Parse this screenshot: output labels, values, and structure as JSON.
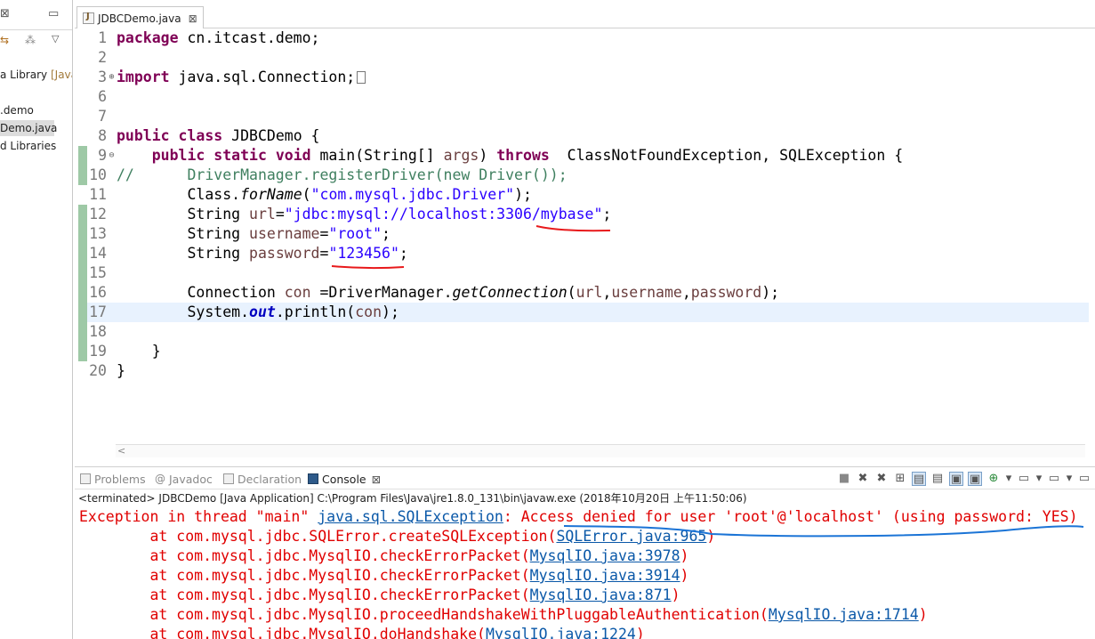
{
  "left": {
    "close_glyph": "⊠",
    "minimize_glyph": "▭",
    "menu_glyph": "▽",
    "items": [
      {
        "label": "a Library",
        "suffix": "[Java"
      },
      {
        "label": ".demo",
        "suffix": ""
      },
      {
        "label": "Demo.java",
        "suffix": ""
      },
      {
        "label": "d Libraries",
        "suffix": ""
      }
    ]
  },
  "editor": {
    "tab_label": "JDBCDemo.java",
    "tab_close": "⊠",
    "lines": [
      {
        "num": "1",
        "fold": ""
      },
      {
        "num": "2",
        "fold": ""
      },
      {
        "num": "3",
        "fold": "⊕"
      },
      {
        "num": "6",
        "fold": ""
      },
      {
        "num": "7",
        "fold": ""
      },
      {
        "num": "8",
        "fold": ""
      },
      {
        "num": "9",
        "fold": "⊖"
      },
      {
        "num": "10",
        "fold": ""
      },
      {
        "num": "11",
        "fold": ""
      },
      {
        "num": "12",
        "fold": ""
      },
      {
        "num": "13",
        "fold": ""
      },
      {
        "num": "14",
        "fold": ""
      },
      {
        "num": "15",
        "fold": ""
      },
      {
        "num": "16",
        "fold": ""
      },
      {
        "num": "17",
        "fold": ""
      },
      {
        "num": "18",
        "fold": ""
      },
      {
        "num": "19",
        "fold": ""
      },
      {
        "num": "20",
        "fold": ""
      }
    ],
    "code": {
      "l1_kw": "package",
      "l1_rest": " cn.itcast.demo;",
      "l3_kw": "import",
      "l3_rest": " java.sql.Connection;",
      "l8_kw": "public class",
      "l8_rest": " JDBCDemo {",
      "l9_indent": "    ",
      "l9_kw1": "public static void",
      "l9_mid": " main(String[] ",
      "l9_var": "args",
      "l9_sp": ") ",
      "l9_kw2": "throws",
      "l9_rest": "  ClassNotFoundException, SQLException {",
      "l10": "//      DriverManager.registerDriver(new Driver());",
      "l11_indent": "        ",
      "l11_a": "Class.",
      "l11_b": "forName",
      "l11_c": "(",
      "l11_str": "\"com.mysql.jdbc.Driver\"",
      "l11_d": ");",
      "l12_a": "        String ",
      "l12_var": "url",
      "l12_eq": "=",
      "l12_str": "\"jdbc:mysql://localhost:3306/mybase\"",
      "l12_end": ";",
      "l13_a": "        String ",
      "l13_var": "username",
      "l13_eq": "=",
      "l13_str": "\"root\"",
      "l13_end": ";",
      "l14_a": "        String ",
      "l14_var": "password",
      "l14_eq": "=",
      "l14_str": "\"123456\"",
      "l14_end": ";",
      "l16_a": "        Connection ",
      "l16_var": "con",
      "l16_b": " =DriverManager.",
      "l16_m": "getConnection",
      "l16_c": "(",
      "l16_v1": "url",
      "l16_comma1": ",",
      "l16_v2": "username",
      "l16_comma2": ",",
      "l16_v3": "password",
      "l16_d": ");",
      "l17_a": "        System.",
      "l17_out": "out",
      "l17_b": ".println(",
      "l17_var": "con",
      "l17_c": ");",
      "l19": "    }",
      "l20": "}"
    },
    "hscroll_arrow": "<"
  },
  "console_view": {
    "tabs": [
      {
        "label": "Problems"
      },
      {
        "label": "Javadoc"
      },
      {
        "label": "Declaration"
      },
      {
        "label": "Console"
      }
    ],
    "tab_close": "⊠",
    "terminated": "<terminated> JDBCDemo [Java Application] C:\\Program Files\\Java\\jre1.8.0_131\\bin\\javaw.exe (2018年10月20日 上午11:50:06)",
    "toolbar_glyphs": [
      "■",
      "✖",
      "✖",
      "⊞",
      "▤",
      "▤",
      "▣",
      "▣",
      "⊕",
      "▾",
      "▭",
      "▾",
      "▭",
      "▾",
      "▭"
    ],
    "exception": {
      "prefix": "Exception in thread \"main\" ",
      "type_link": "java.sql.SQLException",
      "message": ": Access denied for user 'root'@'localhost' (using password: YES)"
    },
    "stack": [
      {
        "at": "        at com.mysql.jdbc.SQLError.createSQLException(",
        "link": "SQLError.java:965",
        "end": ")"
      },
      {
        "at": "        at com.mysql.jdbc.MysqlIO.checkErrorPacket(",
        "link": "MysqlIO.java:3978",
        "end": ")"
      },
      {
        "at": "        at com.mysql.jdbc.MysqlIO.checkErrorPacket(",
        "link": "MysqlIO.java:3914",
        "end": ")"
      },
      {
        "at": "        at com.mysql.jdbc.MysqlIO.checkErrorPacket(",
        "link": "MysqlIO.java:871",
        "end": ")"
      },
      {
        "at": "        at com.mysql.jdbc.MysqlIO.proceedHandshakeWithPluggableAuthentication(",
        "link": "MysqlIO.java:1714",
        "end": ")"
      },
      {
        "at": "        at com.mysql.jdbc.MysqlIO.doHandshake(",
        "link": "MysqlIO.java:1224",
        "end": ")"
      }
    ]
  },
  "colors": {
    "keyword": "#7f0055",
    "string": "#2a00ff",
    "comment": "#3f7f5f",
    "error": "#e00000",
    "link": "#0a58a8",
    "annotation_red": "#e8191b",
    "annotation_blue": "#1b74d6"
  }
}
